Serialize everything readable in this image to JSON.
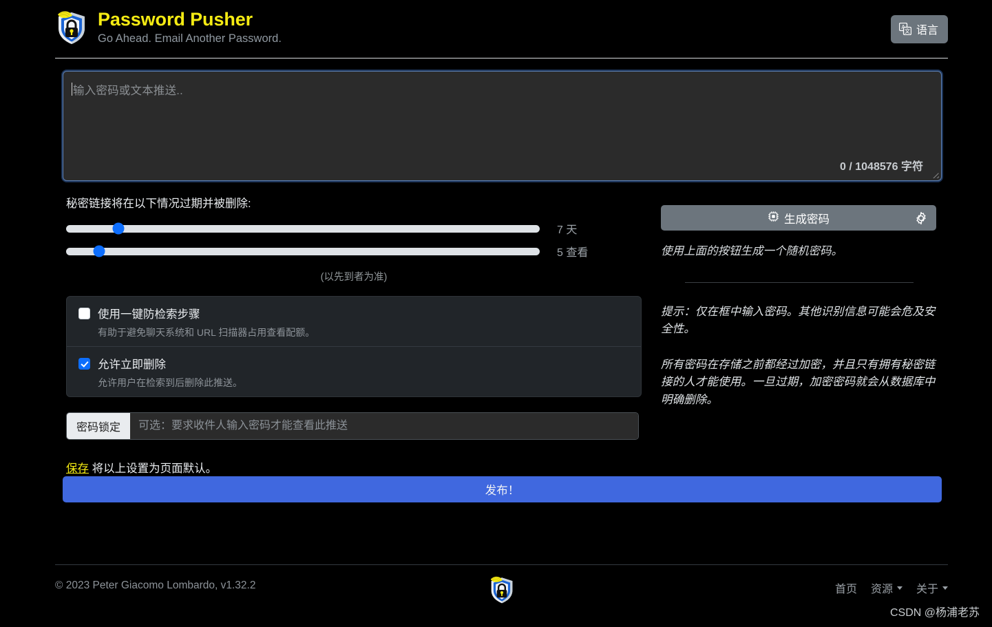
{
  "header": {
    "logo_icon": "shield-lock-push-logo",
    "title": "Password Pusher",
    "subtitle": "Go Ahead. Email Another Password.",
    "language_button": {
      "label": "语言",
      "icon": "translate-icon"
    }
  },
  "editor": {
    "placeholder": "输入密码或文本推送..",
    "value": "",
    "char_counter": "0 / 1048576 字符",
    "focus_ring_color": "#345fa0"
  },
  "expiration": {
    "label": "秘密链接将在以下情况过期并被删除:",
    "sliders": [
      {
        "name": "days-slider",
        "value_label": "7 天",
        "percent": 11
      },
      {
        "name": "views-slider",
        "value_label": "5 查看",
        "percent": 7
      }
    ],
    "whichever_note": "(以先到者为准)"
  },
  "options": [
    {
      "name": "deletable-retrieval-step",
      "title": "使用一键防检索步骤",
      "description": "有助于避免聊天系统和 URL 扫描器占用查看配额。",
      "checked": false
    },
    {
      "name": "allow-immediate-deletion",
      "title": "允许立即删除",
      "description": "允许用户在检索到后删除此推送。",
      "checked": true
    }
  ],
  "passphrase": {
    "label": "密码锁定",
    "placeholder": "可选：要求收件人输入密码才能查看此推送",
    "value": ""
  },
  "save_defaults": {
    "link_label": "保存",
    "rest_text": " 将以上设置为页面默认。"
  },
  "publish": {
    "label": "发布！",
    "color": "#4068df"
  },
  "sidebar": {
    "generate_button": {
      "label": "生成密码",
      "icon": "cpu-chip-icon",
      "settings_icon": "gear-icon"
    },
    "generate_note": "使用上面的按钮生成一个随机密码。",
    "tip": "提示：仅在框中输入密码。其他识别信息可能会危及安全性。",
    "encryption_note": "所有密码在存储之前都经过加密，并且只有拥有秘密链接的人才能使用。一旦过期，加密密码就会从数据库中明确删除。"
  },
  "footer": {
    "copyright": "© 2023 Peter Giacomo Lombardo, v1.32.2",
    "logo_icon": "shield-lock-push-logo",
    "nav": [
      {
        "label": "首页",
        "has_caret": false
      },
      {
        "label": "资源",
        "has_caret": true
      },
      {
        "label": "关于",
        "has_caret": true
      }
    ]
  },
  "watermark": "CSDN @杨浦老苏",
  "colors": {
    "brand_yellow": "#f5eb13",
    "accent_blue": "#0d6efd",
    "publish_blue": "#4068df",
    "background": "#000000"
  }
}
